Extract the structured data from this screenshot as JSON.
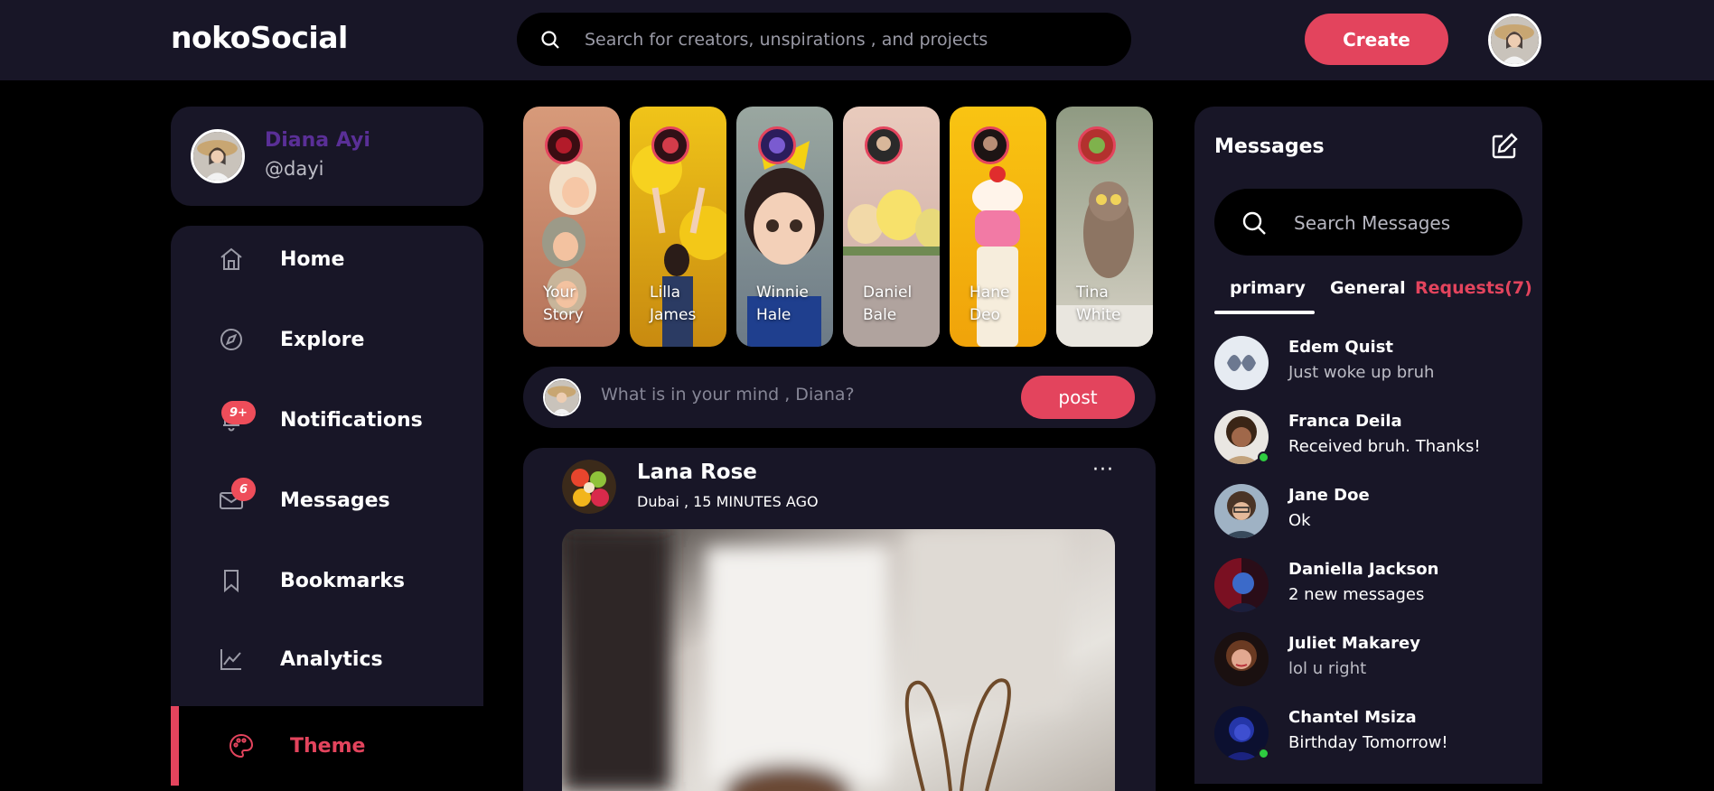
{
  "header": {
    "logo": "nokoSocial",
    "search_placeholder": "Search for creators, unspirations , and projects",
    "create_label": "Create"
  },
  "profile": {
    "name": "Diana Ayi",
    "handle": "@dayi"
  },
  "sidebar": {
    "items": [
      {
        "label": "Home",
        "icon": "home-icon"
      },
      {
        "label": "Explore",
        "icon": "compass-icon"
      },
      {
        "label": "Notifications",
        "icon": "bell-icon",
        "badge": "9+"
      },
      {
        "label": "Messages",
        "icon": "envelope-icon",
        "badge": "6"
      },
      {
        "label": "Bookmarks",
        "icon": "bookmark-icon"
      },
      {
        "label": "Analytics",
        "icon": "chart-icon"
      },
      {
        "label": "Theme",
        "icon": "palette-icon",
        "active": true
      }
    ]
  },
  "stories": [
    {
      "name": "Your Story"
    },
    {
      "name": "Lilla James"
    },
    {
      "name": "Winnie Hale"
    },
    {
      "name": "Daniel Bale"
    },
    {
      "name": "Hane Deo"
    },
    {
      "name": "Tina White"
    }
  ],
  "composer": {
    "placeholder": "What is in your mind , Diana?",
    "post_label": "post"
  },
  "feed": {
    "author": "Lana Rose",
    "meta": "Dubai , 15 MINUTES AGO",
    "more": "···"
  },
  "messages": {
    "title": "Messages",
    "search_placeholder": "Search Messages",
    "tabs": {
      "primary": "primary",
      "general": "General",
      "requests": "Requests(7)"
    },
    "conversations": [
      {
        "name": "Edem Quist",
        "text": "Just woke up bruh",
        "muted": true
      },
      {
        "name": "Franca Deila",
        "text": "Received bruh. Thanks!",
        "online": true
      },
      {
        "name": "Jane Doe",
        "text": "Ok"
      },
      {
        "name": "Daniella Jackson",
        "text": "2 new messages"
      },
      {
        "name": "Juliet Makarey",
        "text": "lol u right",
        "muted": true
      },
      {
        "name": "Chantel Msiza",
        "text": "Birthday Tomorrow!",
        "online": true
      }
    ]
  },
  "colors": {
    "accent": "#e3445d",
    "panel": "#181627",
    "background": "#000000",
    "profile_name": "#5a2f97"
  }
}
